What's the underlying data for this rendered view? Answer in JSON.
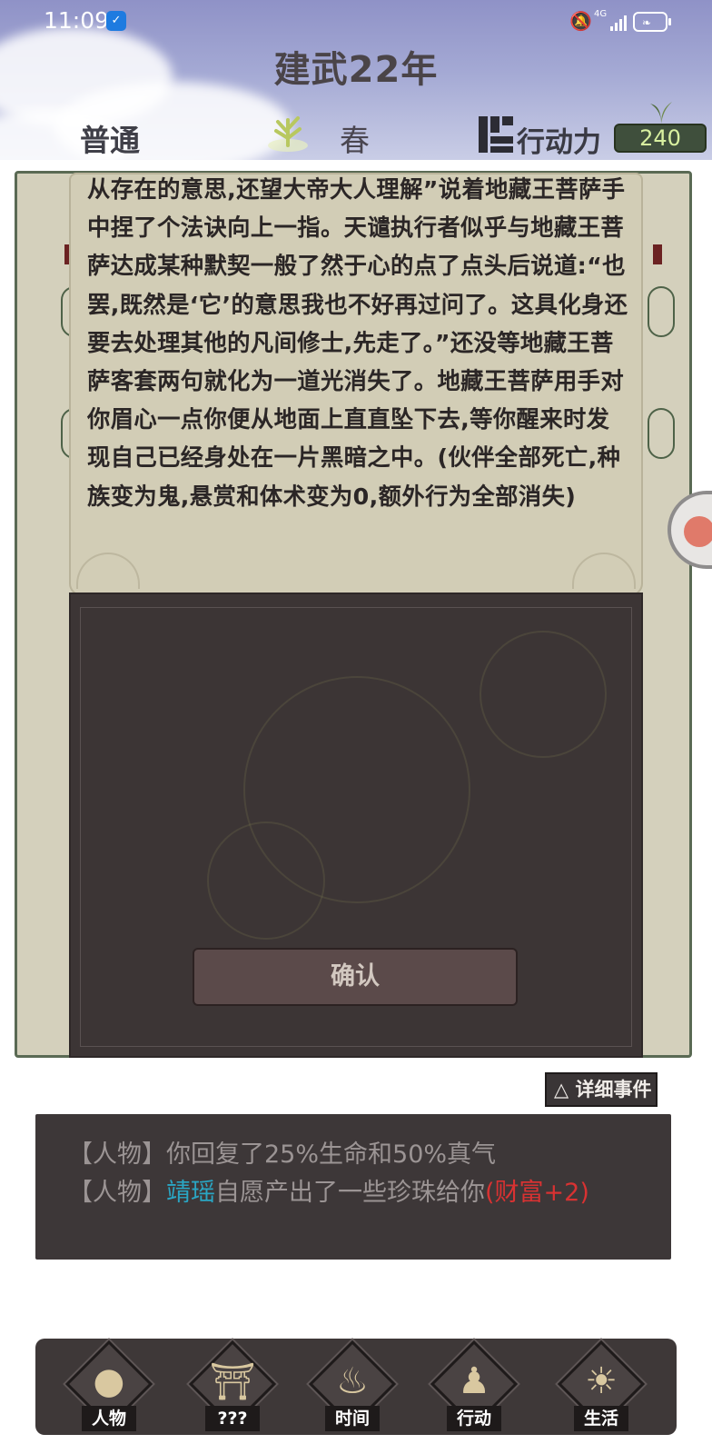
{
  "status": {
    "time": "11:09",
    "network": "4G"
  },
  "header": {
    "year": "建武22年",
    "mode": "普通",
    "season": "春",
    "action_label": "行动力",
    "action_points": "240"
  },
  "popup": {
    "story": "从存在的意思,还望大帝大人理解”说着地藏王菩萨手中捏了个法诀向上一指。天谴执行者似乎与地藏王菩萨达成某种默契一般了然于心的点了点头后说道:“也罢,既然是‘它’的意思我也不好再过问了。这具化身还要去处理其他的凡间修士,先走了。”还没等地藏王菩萨客套两句就化为一道光消失了。地藏王菩萨用手对你眉心一点你便从地面上直直坠下去,等你醒来时发现自己已经身处在一片黑暗之中。(伙伴全部死亡,种族变为鬼,悬赏和体术变为0,额外行为全部消失)",
    "confirm_label": "确认"
  },
  "log": {
    "detail_button": "△ 详细事件",
    "line1": "【人物】你回复了25%生命和50%真气",
    "line2_prefix": "【人物】",
    "line2_name": "靖瑶",
    "line2_mid": "自愿产出了一些珍珠给你",
    "line2_reward": "(财富+2)"
  },
  "nav": [
    {
      "label": "人物",
      "icon": "person-icon"
    },
    {
      "label": "???",
      "icon": "gate-icon"
    },
    {
      "label": "时间",
      "icon": "incense-icon"
    },
    {
      "label": "行动",
      "icon": "action-icon"
    },
    {
      "label": "生活",
      "icon": "field-icon"
    }
  ]
}
